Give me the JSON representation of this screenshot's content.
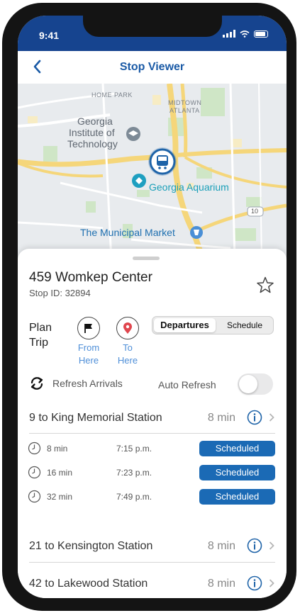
{
  "status": {
    "time": "9:41"
  },
  "nav": {
    "title": "Stop Viewer"
  },
  "map": {
    "labels": {
      "home_park": "HOME PARK",
      "midtown": "MIDTOWN",
      "atlanta": "ATLANTA",
      "gt_line1": "Georgia",
      "gt_line2": "Institute of",
      "gt_line3": "Technology",
      "aquarium": "Georgia Aquarium",
      "market": "The Municipal Market",
      "shield": "10"
    },
    "colors": {
      "road": "#f5d67a",
      "park": "#cfe6c6",
      "water": "#a8d6ec",
      "label": "#1d6fb0",
      "pin": "#1e63a8"
    }
  },
  "stop": {
    "name": "459 Womkep Center",
    "id_label": "Stop ID: 32894"
  },
  "plan_trip": {
    "label_line1": "Plan",
    "label_line2": "Trip",
    "from_line1": "From",
    "from_line2": "Here",
    "to_line1": "To",
    "to_line2": "Here"
  },
  "tabs": {
    "departures": "Departures",
    "schedule": "Schedule",
    "active": "departures"
  },
  "refresh": {
    "label": "Refresh Arrivals",
    "auto_label": "Auto Refresh",
    "auto_on": false
  },
  "routes": [
    {
      "name": "9 to King Memorial Station",
      "eta": "8 min"
    },
    {
      "name": "21 to Kensington Station",
      "eta": "8 min"
    },
    {
      "name": "42 to Lakewood Station",
      "eta": "8 min"
    }
  ],
  "departures": [
    {
      "wait": "8 min",
      "time": "7:15 p.m.",
      "status": "Scheduled"
    },
    {
      "wait": "16 min",
      "time": "7:23 p.m.",
      "status": "Scheduled"
    },
    {
      "wait": "32 min",
      "time": "7:49 p.m.",
      "status": "Scheduled"
    }
  ],
  "colors": {
    "accent": "#16448f",
    "link": "#4f8fd8",
    "badge": "#1b6ab5"
  }
}
